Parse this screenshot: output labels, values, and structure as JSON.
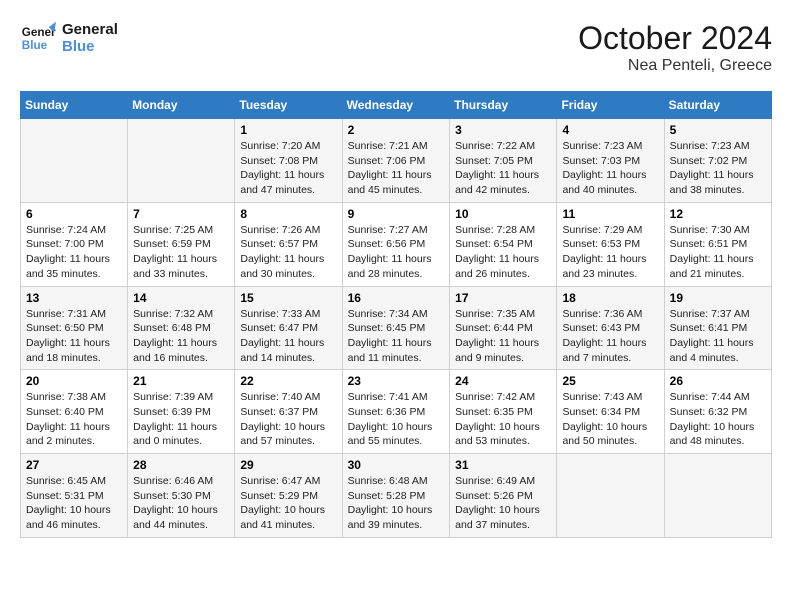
{
  "header": {
    "logo_line1": "General",
    "logo_line2": "Blue",
    "month": "October 2024",
    "location": "Nea Penteli, Greece"
  },
  "weekdays": [
    "Sunday",
    "Monday",
    "Tuesday",
    "Wednesday",
    "Thursday",
    "Friday",
    "Saturday"
  ],
  "weeks": [
    [
      {
        "day": "",
        "info": ""
      },
      {
        "day": "",
        "info": ""
      },
      {
        "day": "1",
        "info": "Sunrise: 7:20 AM\nSunset: 7:08 PM\nDaylight: 11 hours and 47 minutes."
      },
      {
        "day": "2",
        "info": "Sunrise: 7:21 AM\nSunset: 7:06 PM\nDaylight: 11 hours and 45 minutes."
      },
      {
        "day": "3",
        "info": "Sunrise: 7:22 AM\nSunset: 7:05 PM\nDaylight: 11 hours and 42 minutes."
      },
      {
        "day": "4",
        "info": "Sunrise: 7:23 AM\nSunset: 7:03 PM\nDaylight: 11 hours and 40 minutes."
      },
      {
        "day": "5",
        "info": "Sunrise: 7:23 AM\nSunset: 7:02 PM\nDaylight: 11 hours and 38 minutes."
      }
    ],
    [
      {
        "day": "6",
        "info": "Sunrise: 7:24 AM\nSunset: 7:00 PM\nDaylight: 11 hours and 35 minutes."
      },
      {
        "day": "7",
        "info": "Sunrise: 7:25 AM\nSunset: 6:59 PM\nDaylight: 11 hours and 33 minutes."
      },
      {
        "day": "8",
        "info": "Sunrise: 7:26 AM\nSunset: 6:57 PM\nDaylight: 11 hours and 30 minutes."
      },
      {
        "day": "9",
        "info": "Sunrise: 7:27 AM\nSunset: 6:56 PM\nDaylight: 11 hours and 28 minutes."
      },
      {
        "day": "10",
        "info": "Sunrise: 7:28 AM\nSunset: 6:54 PM\nDaylight: 11 hours and 26 minutes."
      },
      {
        "day": "11",
        "info": "Sunrise: 7:29 AM\nSunset: 6:53 PM\nDaylight: 11 hours and 23 minutes."
      },
      {
        "day": "12",
        "info": "Sunrise: 7:30 AM\nSunset: 6:51 PM\nDaylight: 11 hours and 21 minutes."
      }
    ],
    [
      {
        "day": "13",
        "info": "Sunrise: 7:31 AM\nSunset: 6:50 PM\nDaylight: 11 hours and 18 minutes."
      },
      {
        "day": "14",
        "info": "Sunrise: 7:32 AM\nSunset: 6:48 PM\nDaylight: 11 hours and 16 minutes."
      },
      {
        "day": "15",
        "info": "Sunrise: 7:33 AM\nSunset: 6:47 PM\nDaylight: 11 hours and 14 minutes."
      },
      {
        "day": "16",
        "info": "Sunrise: 7:34 AM\nSunset: 6:45 PM\nDaylight: 11 hours and 11 minutes."
      },
      {
        "day": "17",
        "info": "Sunrise: 7:35 AM\nSunset: 6:44 PM\nDaylight: 11 hours and 9 minutes."
      },
      {
        "day": "18",
        "info": "Sunrise: 7:36 AM\nSunset: 6:43 PM\nDaylight: 11 hours and 7 minutes."
      },
      {
        "day": "19",
        "info": "Sunrise: 7:37 AM\nSunset: 6:41 PM\nDaylight: 11 hours and 4 minutes."
      }
    ],
    [
      {
        "day": "20",
        "info": "Sunrise: 7:38 AM\nSunset: 6:40 PM\nDaylight: 11 hours and 2 minutes."
      },
      {
        "day": "21",
        "info": "Sunrise: 7:39 AM\nSunset: 6:39 PM\nDaylight: 11 hours and 0 minutes."
      },
      {
        "day": "22",
        "info": "Sunrise: 7:40 AM\nSunset: 6:37 PM\nDaylight: 10 hours and 57 minutes."
      },
      {
        "day": "23",
        "info": "Sunrise: 7:41 AM\nSunset: 6:36 PM\nDaylight: 10 hours and 55 minutes."
      },
      {
        "day": "24",
        "info": "Sunrise: 7:42 AM\nSunset: 6:35 PM\nDaylight: 10 hours and 53 minutes."
      },
      {
        "day": "25",
        "info": "Sunrise: 7:43 AM\nSunset: 6:34 PM\nDaylight: 10 hours and 50 minutes."
      },
      {
        "day": "26",
        "info": "Sunrise: 7:44 AM\nSunset: 6:32 PM\nDaylight: 10 hours and 48 minutes."
      }
    ],
    [
      {
        "day": "27",
        "info": "Sunrise: 6:45 AM\nSunset: 5:31 PM\nDaylight: 10 hours and 46 minutes."
      },
      {
        "day": "28",
        "info": "Sunrise: 6:46 AM\nSunset: 5:30 PM\nDaylight: 10 hours and 44 minutes."
      },
      {
        "day": "29",
        "info": "Sunrise: 6:47 AM\nSunset: 5:29 PM\nDaylight: 10 hours and 41 minutes."
      },
      {
        "day": "30",
        "info": "Sunrise: 6:48 AM\nSunset: 5:28 PM\nDaylight: 10 hours and 39 minutes."
      },
      {
        "day": "31",
        "info": "Sunrise: 6:49 AM\nSunset: 5:26 PM\nDaylight: 10 hours and 37 minutes."
      },
      {
        "day": "",
        "info": ""
      },
      {
        "day": "",
        "info": ""
      }
    ]
  ]
}
